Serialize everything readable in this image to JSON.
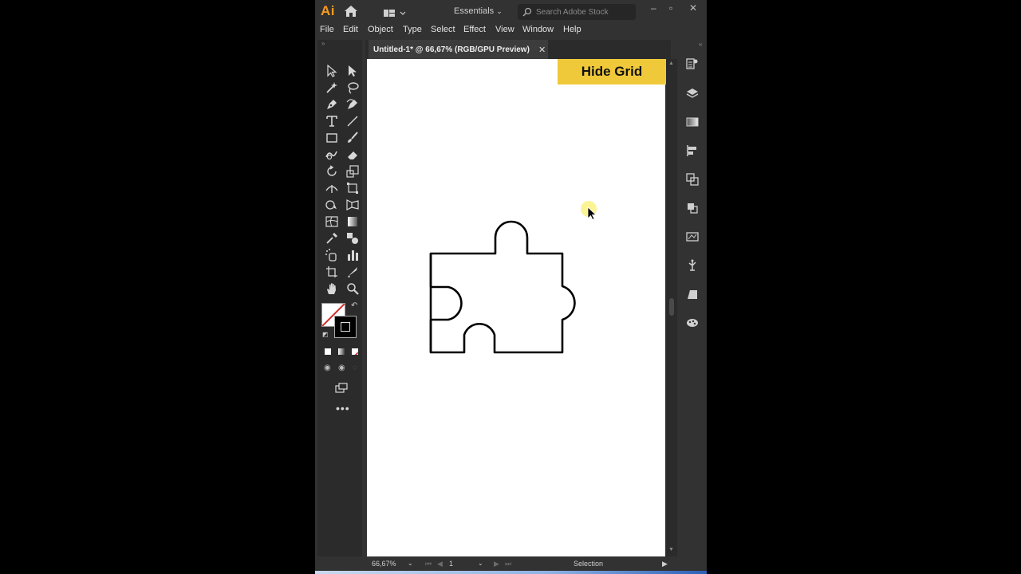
{
  "app": {
    "logo": "Ai",
    "workspace": "Essentials",
    "search_placeholder": "Search Adobe Stock",
    "colors": {
      "accent": "#f59a23",
      "chrome": "#323232",
      "highlight": "#f0c93a"
    }
  },
  "menu": [
    "File",
    "Edit",
    "Object",
    "Type",
    "Select",
    "Effect",
    "View",
    "Window",
    "Help"
  ],
  "document": {
    "tab_title": "Untitled-1* @ 66,67% (RGB/GPU Preview)",
    "close_glyph": "✕"
  },
  "overlay": {
    "hide_grid": "Hide Grid"
  },
  "status": {
    "zoom": "66,67%",
    "artboard": "1",
    "tool": "Selection"
  },
  "icons": {
    "toolbar": [
      "selection-tool",
      "direct-selection-tool",
      "magic-wand-tool",
      "lasso-tool",
      "pen-tool",
      "curvature-tool",
      "type-tool",
      "line-segment-tool",
      "rectangle-tool",
      "paintbrush-tool",
      "shaper-tool",
      "eraser-tool",
      "rotate-tool",
      "scale-tool",
      "width-tool",
      "free-transform-tool",
      "shape-builder-tool",
      "perspective-grid-tool",
      "mesh-tool",
      "gradient-tool",
      "eyedropper-tool",
      "blend-tool",
      "symbol-sprayer-tool",
      "column-graph-tool",
      "artboard-tool",
      "slice-tool",
      "hand-tool",
      "zoom-tool"
    ],
    "right_panel": [
      "properties-icon",
      "layers-icon",
      "gradient-panel-icon",
      "align-icon",
      "transform-icon",
      "pathfinder-icon",
      "image-trace-icon",
      "puppet-warp-icon",
      "shear-icon",
      "color-guide-icon"
    ]
  }
}
